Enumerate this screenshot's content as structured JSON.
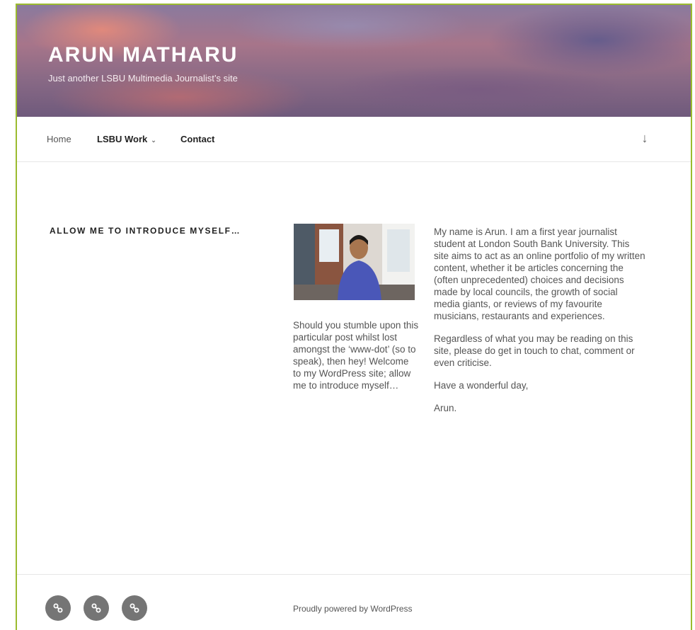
{
  "site": {
    "title": "ARUN MATHARU",
    "description": "Just another LSBU Multimedia Journalist’s site"
  },
  "nav": {
    "items": [
      {
        "label": "Home"
      },
      {
        "label": "LSBU Work",
        "has_submenu": true
      },
      {
        "label": "Contact"
      }
    ],
    "scroll_icon": "arrow-down-icon",
    "submenu_icon": "chevron-down-icon"
  },
  "post": {
    "title": "ALLOW ME TO INTRODUCE MYSELF…",
    "left_text": "Should you stumble upon this particular post whilst lost amongst the ‘www-dot’ (so to speak), then hey! Welcome to my WordPress site; allow me to introduce myself…",
    "paragraphs": [
      "My name is Arun. I am a first year journalist student at London South Bank University. This site aims to act as an online portfolio of my written content, whether it be articles concerning the (often unprecedented) choices and decisions made by local councils, the growth of social media giants, or reviews of my favourite musicians, restaurants and experiences.",
      "Regardless of what you may be reading on this site, please do get in touch to chat, comment or even criticise.",
      "Have a wonderful day,",
      "Arun."
    ]
  },
  "footer": {
    "social_icons": [
      "link-icon",
      "link-icon",
      "link-icon"
    ],
    "powered_by": "Proudly powered by WordPress"
  },
  "colors": {
    "frame_border": "#9bbb2f",
    "social_bg": "#757575"
  }
}
